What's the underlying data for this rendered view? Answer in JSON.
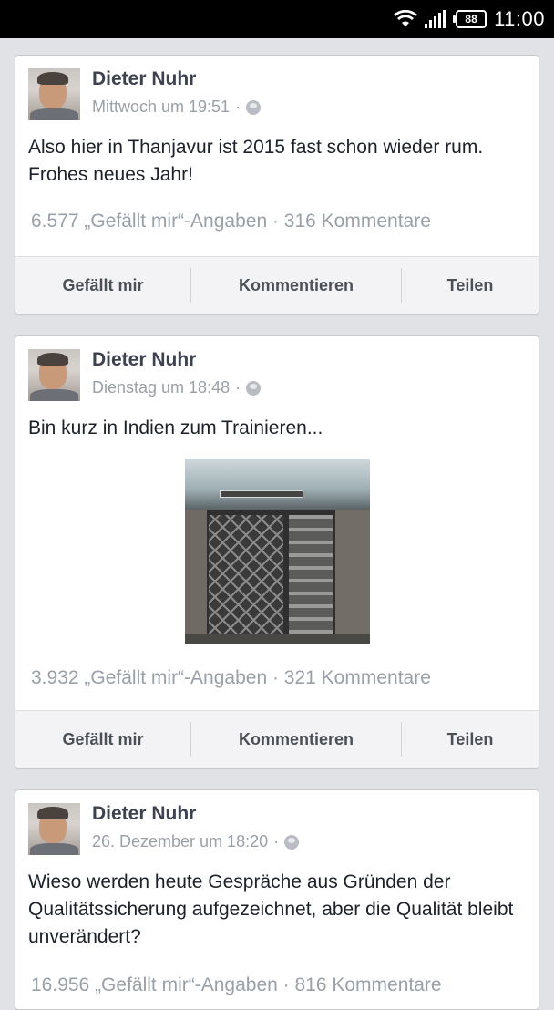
{
  "status_bar": {
    "battery": "88",
    "time": "11:00"
  },
  "posts": [
    {
      "author": "Dieter Nuhr",
      "time": "Mittwoch um 19:51",
      "separator": "·",
      "text": "Also hier in Thanjavur ist 2015 fast schon wieder rum. Frohes neues Jahr!",
      "stats": "6.577 „Gefällt mir“-Angaben · 316 Kommentare"
    },
    {
      "author": "Dieter Nuhr",
      "time": "Dienstag um 18:48",
      "separator": "·",
      "text": "Bin kurz in Indien zum Trainieren...",
      "stats": "3.932 „Gefällt mir“-Angaben · 321 Kommentare"
    },
    {
      "author": "Dieter Nuhr",
      "time": "26. Dezember um 18:20",
      "separator": "·",
      "text": "Wieso werden heute Gespräche aus Gründen der Qualitätssicherung aufgezeichnet, aber die Qualität bleibt unverändert?",
      "stats": "16.956 „Gefällt mir“-Angaben · 816 Kommentare"
    }
  ],
  "actions": {
    "like": "Gefällt mir",
    "comment": "Kommentieren",
    "share": "Teilen"
  }
}
